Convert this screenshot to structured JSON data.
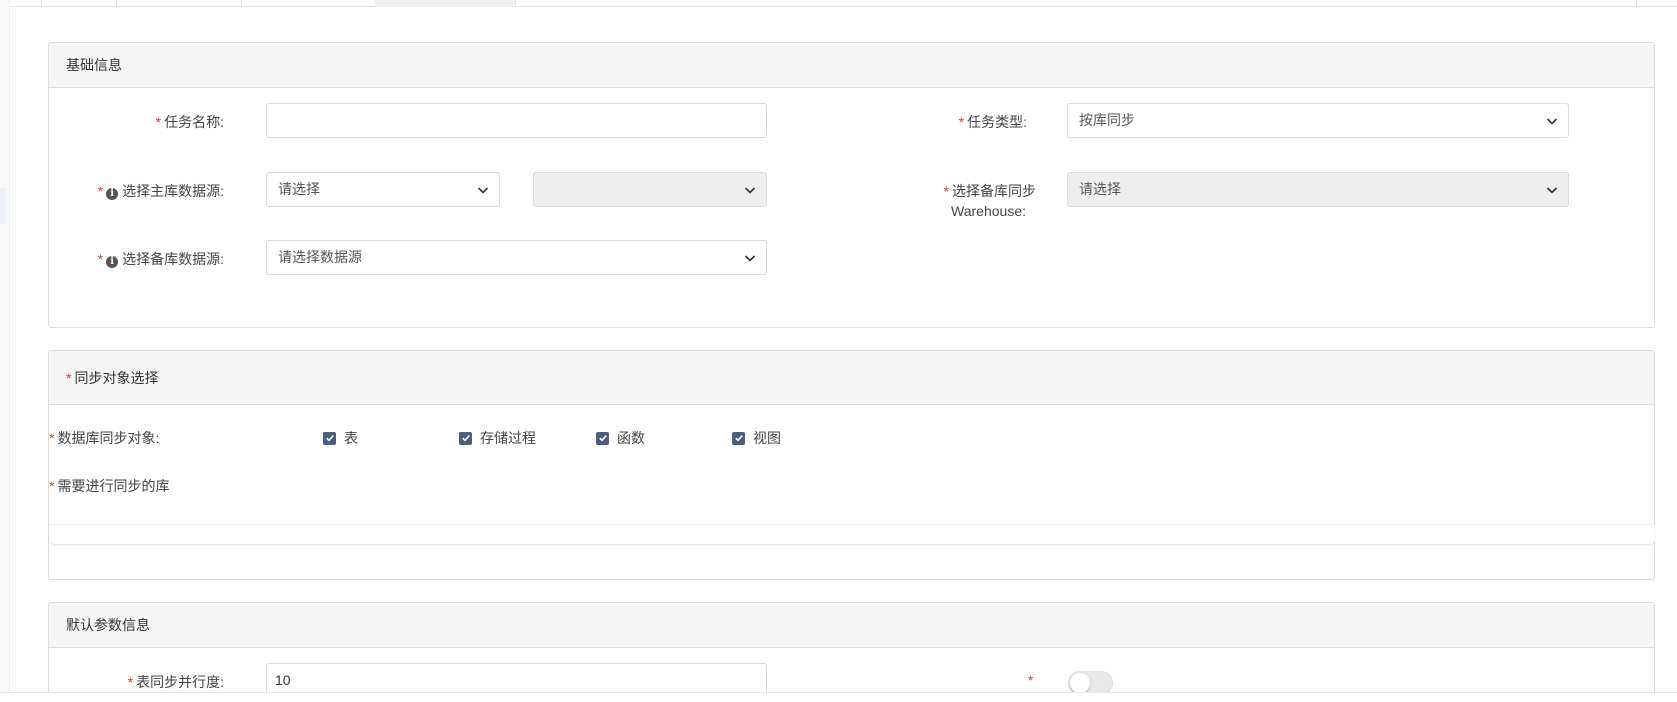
{
  "basic_info": {
    "title": "基础信息",
    "task_name": {
      "label": "任务名称:",
      "value": "",
      "placeholder": ""
    },
    "task_type": {
      "label": "任务类型:",
      "value": "按库同步"
    },
    "primary_source": {
      "label": "选择主库数据源:",
      "value": "请选择",
      "secondary_value": ""
    },
    "standby_warehouse": {
      "label_line1": "选择备库同步",
      "label_line2": "Warehouse:",
      "value": "请选择"
    },
    "standby_source": {
      "label": "选择备库数据源:",
      "value": "请选择数据源"
    }
  },
  "sync_objects": {
    "title": "同步对象选择",
    "objects_label": "数据库同步对象:",
    "objects": [
      {
        "label": "表",
        "checked": true
      },
      {
        "label": "存储过程",
        "checked": true
      },
      {
        "label": "函数",
        "checked": true
      },
      {
        "label": "视图",
        "checked": true
      }
    ],
    "databases_label": "需要进行同步的库"
  },
  "default_params": {
    "title": "默认参数信息",
    "parallelism": {
      "label": "表同步并行度:",
      "value": "10"
    },
    "toggle": {
      "on": false
    }
  },
  "colors": {
    "required": "#e4393c",
    "checkbox": "#4a5d7e",
    "panel_header": "#f5f5f5",
    "border": "#dcdcdc"
  }
}
